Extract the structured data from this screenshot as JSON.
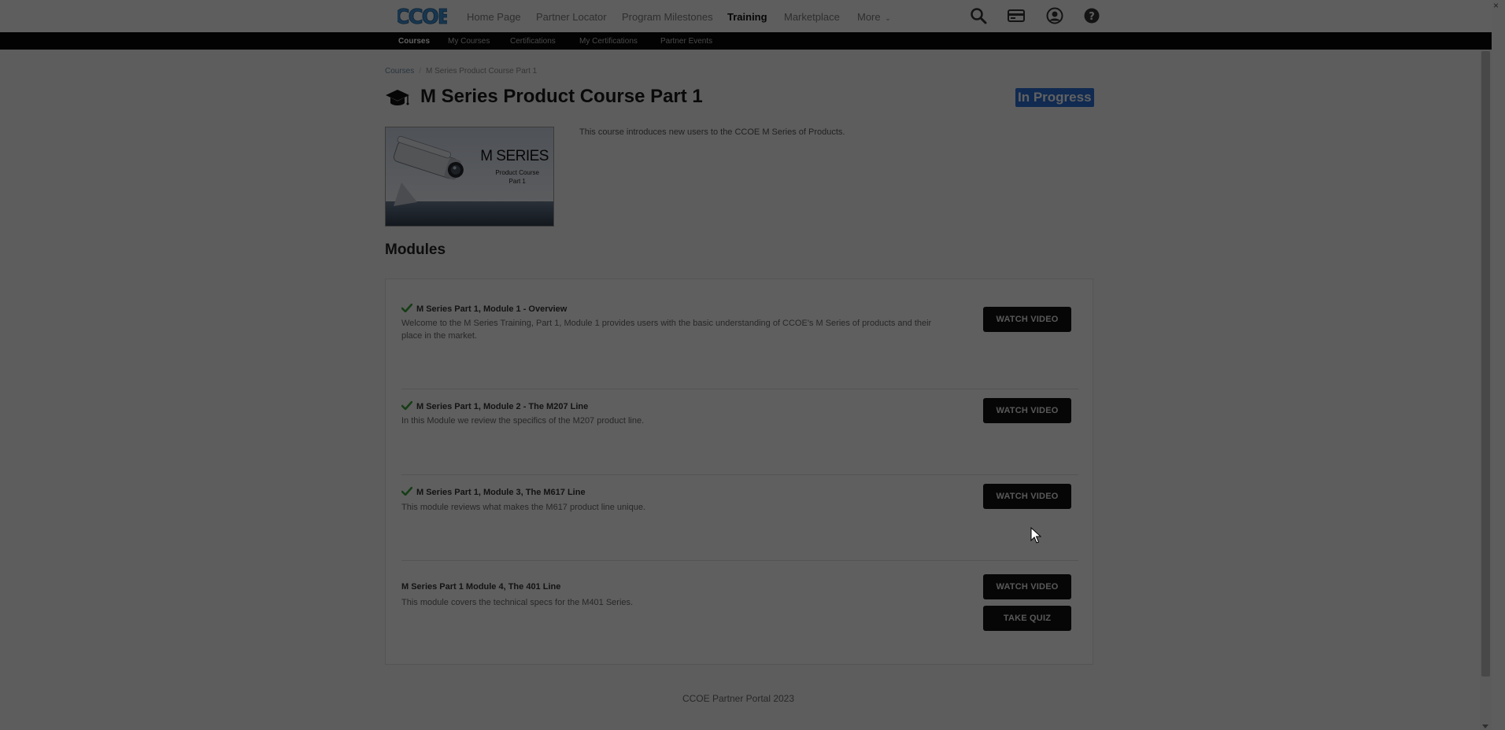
{
  "topnav": {
    "logo_text": "CCOE",
    "links": [
      {
        "label": "Home Page"
      },
      {
        "label": "Partner Locator"
      },
      {
        "label": "Program Milestones"
      },
      {
        "label": "Training"
      },
      {
        "label": "Marketplace"
      },
      {
        "label": "More"
      }
    ],
    "active": "Training",
    "icons": [
      "search-icon",
      "card-icon",
      "user-icon",
      "help-icon"
    ]
  },
  "subnav": {
    "links": [
      {
        "label": "Courses"
      },
      {
        "label": "My Courses"
      },
      {
        "label": "Certifications"
      },
      {
        "label": "My Certifications"
      },
      {
        "label": "Partner Events"
      }
    ],
    "active": "Courses"
  },
  "breadcrumb": {
    "root": "Courses",
    "current": "M Series Product Course Part 1"
  },
  "course": {
    "title": "M Series Product Course Part 1",
    "status": "In Progress",
    "image_title": "M SERIES",
    "image_subtitle_1": "Product Course",
    "image_subtitle_2": "Part 1",
    "description": "This course introduces new users to the CCOE M Series of Products."
  },
  "modules": {
    "heading": "Modules",
    "items": [
      {
        "title": "M Series Part 1, Module 1 - Overview",
        "description": "Welcome to the M Series Training, Part 1, Module 1 provides users with the basic understanding of CCOE's M Series of products and their place in the market.",
        "completed": true,
        "watch_label": "WATCH VIDEO"
      },
      {
        "title": "M Series Part 1, Module 2 - The M207 Line",
        "description": "In this Module we review the specifics of the M207 product line.",
        "completed": true,
        "watch_label": "WATCH VIDEO"
      },
      {
        "title": "M Series Part 1, Module 3, The M617 Line",
        "description": "This module reviews what makes the M617 product line unique.",
        "completed": true,
        "watch_label": "WATCH VIDEO"
      },
      {
        "title": "M Series Part 1 Module 4, The 401 Line",
        "description": "This module covers the technical specs for the M401 Series.",
        "completed": false,
        "watch_label": "WATCH VIDEO",
        "quiz_label": "TAKE QUIZ"
      }
    ]
  },
  "footer": {
    "text": "CCOE Partner Portal 2023"
  },
  "colors": {
    "status_badge": "#2c6fd6",
    "check": "#3aa13a",
    "button": "#111111",
    "subnav": "#0a0a0a"
  }
}
